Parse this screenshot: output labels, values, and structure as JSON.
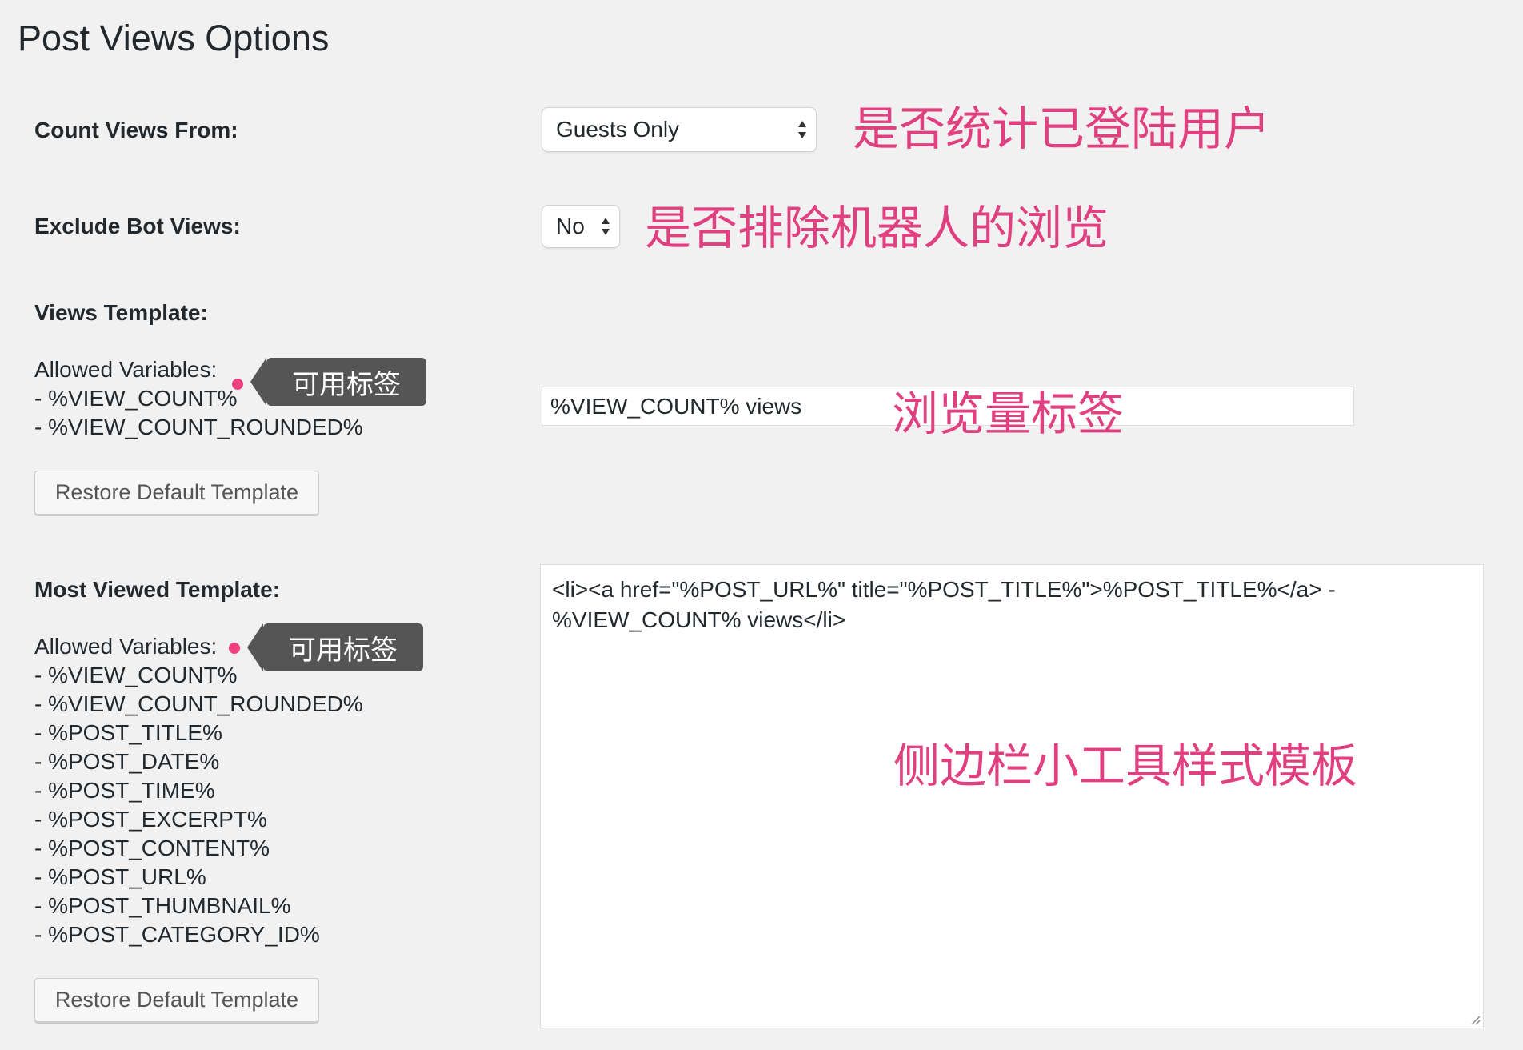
{
  "page": {
    "title": "Post Views Options"
  },
  "count_views": {
    "label": "Count Views From:",
    "selected": "Guests Only",
    "annotation": "是否统计已登陆用户"
  },
  "exclude_bot": {
    "label": "Exclude Bot Views:",
    "selected": "No",
    "annotation": "是否排除机器人的浏览"
  },
  "views_template": {
    "label": "Views Template:",
    "allowed_label": "Allowed Variables:",
    "tag": "可用标签",
    "variables": [
      "- %VIEW_COUNT%",
      "- %VIEW_COUNT_ROUNDED%"
    ],
    "input_value": "%VIEW_COUNT% views",
    "annotation": "浏览量标签",
    "restore_label": "Restore Default Template"
  },
  "most_viewed": {
    "label": "Most Viewed Template:",
    "allowed_label": "Allowed Variables:",
    "tag": "可用标签",
    "variables": [
      "- %VIEW_COUNT%",
      "- %VIEW_COUNT_ROUNDED%",
      "- %POST_TITLE%",
      "- %POST_DATE%",
      "- %POST_TIME%",
      "- %POST_EXCERPT%",
      "- %POST_CONTENT%",
      "- %POST_URL%",
      "- %POST_THUMBNAIL%",
      "- %POST_CATEGORY_ID%"
    ],
    "textarea_line1": "<li><a href=\"%POST_URL%\"  title=\"%POST_TITLE%\">%POST_TITLE%</a> -",
    "textarea_line2": "%VIEW_COUNT% views</li>",
    "annotation": "侧边栏小工具样式模板",
    "restore_label": "Restore Default Template"
  },
  "colors": {
    "annotation": "#e0407f",
    "tag_bg": "#555555",
    "page_bg": "#f1f1f1"
  }
}
